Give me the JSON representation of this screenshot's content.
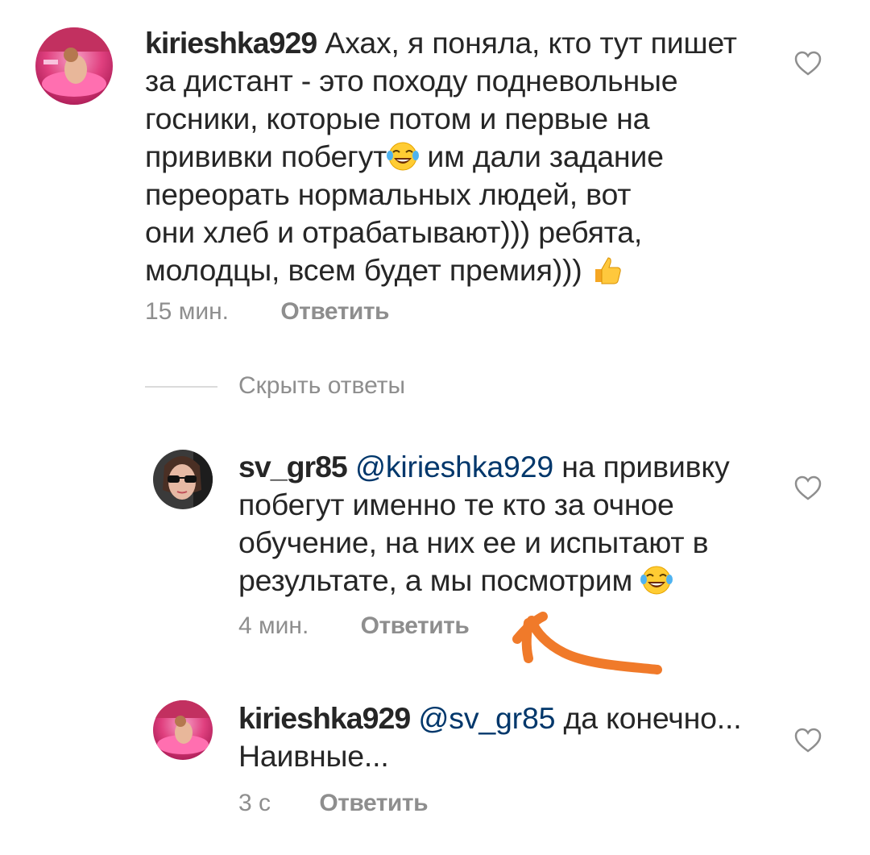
{
  "comments": [
    {
      "username": "kirieshka929",
      "lines": [
        "Ахах, я поняла, кто тут пишет",
        "за дистант - это походу подневольные",
        "госники, которые потом и первые на",
        "прививки побегут",
        "им дали задание",
        "переорать нормальных людей, вот",
        "они хлеб и отрабатывают))) ребята,",
        "молодцы, всем будет премия)))"
      ],
      "time": "15 мин.",
      "reply_label": "Ответить",
      "like_icon": "heart-outline-icon"
    },
    {
      "username": "sv_gr85",
      "mention": "@kirieshka929",
      "lines": [
        "на прививку",
        "побегут именно те кто за очное",
        "обучение, на них ее и испытают в",
        "результате, а мы посмотрим"
      ],
      "time": "4 мин.",
      "reply_label": "Ответить",
      "like_icon": "heart-outline-icon"
    },
    {
      "username": "kirieshka929",
      "mention": "@sv_gr85",
      "lines": [
        "да конечно...",
        "Наивные..."
      ],
      "time": "3 с",
      "reply_label": "Ответить",
      "like_icon": "heart-outline-icon"
    }
  ],
  "hide_replies_label": "Скрыть ответы",
  "colors": {
    "text": "#262626",
    "secondary": "#8e8e8e",
    "mention": "#00376b",
    "arrow": "#f07a2a"
  }
}
